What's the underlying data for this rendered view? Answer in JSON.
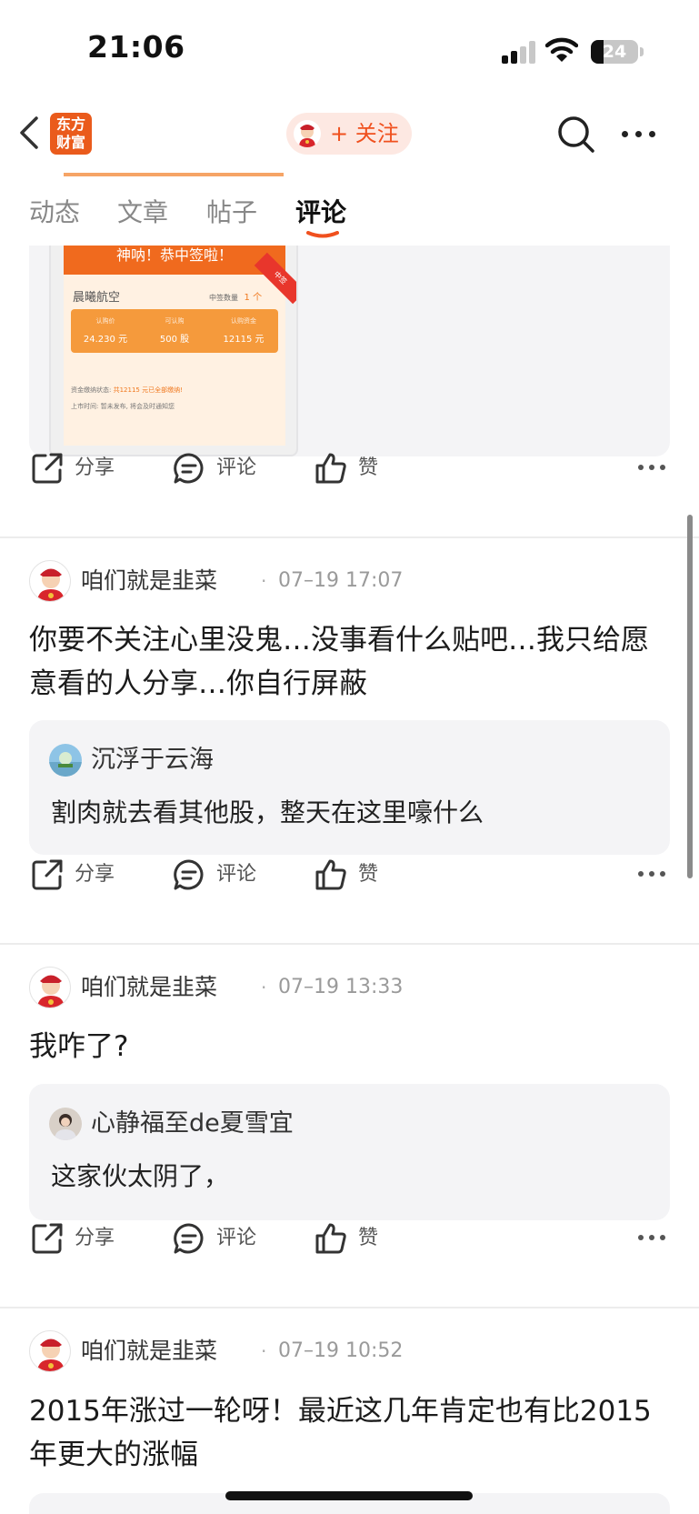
{
  "status_bar": {
    "time": "21:06",
    "battery": "24"
  },
  "nav": {
    "logo_line1": "东方",
    "logo_line2": "财富",
    "follow_label": "+ 关注"
  },
  "tabs": [
    {
      "label": "动态",
      "active": false
    },
    {
      "label": "文章",
      "active": false
    },
    {
      "label": "帖子",
      "active": false
    },
    {
      "label": "评论",
      "active": true
    }
  ],
  "image_card": {
    "banner": "神呐！恭中签啦！",
    "stock_name": "晨曦航空",
    "count_label": "中签数量",
    "count_value": "1 个",
    "ribbon": "中签",
    "cols": [
      {
        "h": "认购价",
        "v": "24.230 元"
      },
      {
        "h": "可认购",
        "v": "500 股"
      },
      {
        "h": "认购资金",
        "v": "12115 元"
      }
    ],
    "line1_label": "资金缴纳状态:",
    "line1_value": "共12115 元已全部缴纳!",
    "line2": "上市时间:   暂未发布, 将会及时通知您"
  },
  "actions": {
    "share": "分享",
    "comment": "评论",
    "like": "赞"
  },
  "posts": [
    {
      "author": "咱们就是韭菜",
      "time": "07–19 17:07",
      "text": "你要不关注心里没鬼…没事看什么贴吧…我只给愿意看的人分享…你自行屏蔽",
      "quote_author": "沉浮于云海",
      "quote_text": "割肉就去看其他股，整天在这里嚎什么"
    },
    {
      "author": "咱们就是韭菜",
      "time": "07–19 13:33",
      "text": "我咋了?",
      "quote_author": "心静福至de夏雪宜",
      "quote_text": "这家伙太阴了，"
    },
    {
      "author": "咱们就是韭菜",
      "time": "07–19 10:52",
      "text": "2015年涨过一轮呀！最近这几年肯定也有比2015年更大的涨幅"
    }
  ],
  "colors": {
    "brand": "#ea5b1c",
    "follow_text": "#f0501e",
    "card_bg": "#f4f4f6"
  }
}
